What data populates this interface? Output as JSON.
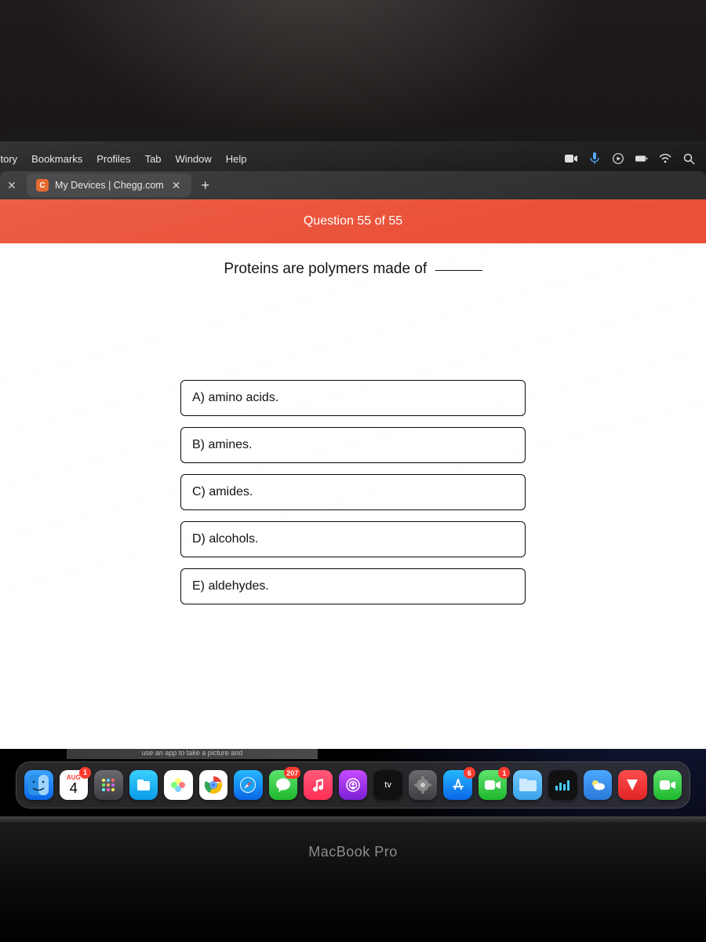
{
  "menubar": {
    "items": [
      "story",
      "Bookmarks",
      "Profiles",
      "Tab",
      "Window",
      "Help"
    ]
  },
  "tabs": {
    "active": {
      "title": "My Devices | Chegg.com",
      "favicon_letter": "C"
    }
  },
  "quiz": {
    "header": "Question 55 of 55",
    "prompt": "Proteins are polymers made of",
    "answers": [
      "A) amino acids.",
      "B) amines.",
      "C) amides.",
      "D) alcohols.",
      "E) aldehydes."
    ]
  },
  "promo": "use an app to take a picture and",
  "dock": {
    "calendar": {
      "month": "AUG",
      "day": "4",
      "badge": "1"
    },
    "messages_badge": "207",
    "appstore_badge": "6",
    "facetime_badge": "1",
    "tv_label": "tv"
  },
  "laptop": "MacBook Pro",
  "chart_data": null
}
